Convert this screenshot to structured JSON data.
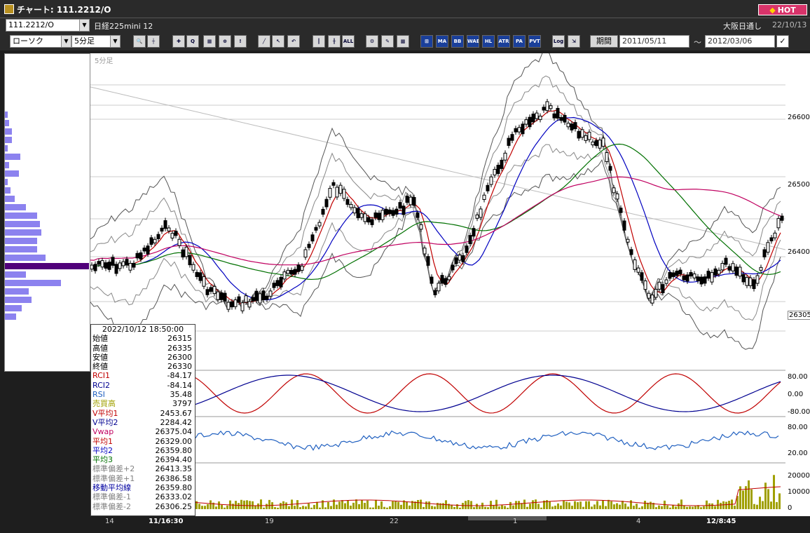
{
  "window": {
    "title": "チャート: 111.2212/O",
    "hot_label": "HOT"
  },
  "selector": {
    "symbol": "111.2212/O",
    "name": "日経225mini 12",
    "exchange": "大阪日通し",
    "date": "22/10/13",
    "chart_type": "ローソク",
    "interval": "5分足"
  },
  "toolbar": {
    "buttons": [
      {
        "name": "zoom-icon",
        "label": "🔍"
      },
      {
        "name": "crosshair-icon",
        "label": "┼"
      },
      {
        "name": "mark-icon",
        "label": "✚"
      },
      {
        "name": "zoom-chart-icon",
        "label": "Q"
      },
      {
        "name": "fit-icon",
        "label": "▦"
      },
      {
        "name": "split-icon",
        "label": "⊕"
      },
      {
        "name": "info-icon",
        "label": "!"
      },
      {
        "name": "draw-line-icon",
        "label": "╱"
      },
      {
        "name": "cursor-icon",
        "label": "↖"
      },
      {
        "name": "undo-icon",
        "label": "↶"
      },
      {
        "name": "candle-icon",
        "label": "║"
      },
      {
        "name": "candle2-icon",
        "label": "╫"
      },
      {
        "name": "all-icon",
        "label": "ALL"
      },
      {
        "name": "settings-icon",
        "label": "⚙"
      },
      {
        "name": "tool-icon",
        "label": "✎"
      },
      {
        "name": "color-icon",
        "label": "▩"
      },
      {
        "name": "grid-icon",
        "label": "⊞"
      },
      {
        "name": "ma-icon",
        "label": "MA"
      },
      {
        "name": "bb-icon",
        "label": "BB"
      },
      {
        "name": "wae-icon",
        "label": "WAE"
      },
      {
        "name": "hl-icon",
        "label": "HL"
      },
      {
        "name": "atr-icon",
        "label": "ATR"
      },
      {
        "name": "pa-icon",
        "label": "PA"
      },
      {
        "name": "pvt-icon",
        "label": "PVT"
      },
      {
        "name": "log-icon",
        "label": "Log"
      },
      {
        "name": "export-icon",
        "label": "⇲"
      }
    ],
    "period_label": "期間",
    "date_from": "2011/05/11",
    "date_to": "2012/03/06",
    "tilde": "〜"
  },
  "chart": {
    "interval_label": "5分足",
    "price_labels": [
      "26600",
      "26500",
      "26400"
    ],
    "current_price": "26305",
    "rci_labels": [
      "80.00",
      "0.00",
      "-80.00"
    ],
    "rsi_labels": [
      "80.00",
      "20.00"
    ],
    "volume_labels": [
      "20000",
      "10000",
      "0"
    ],
    "x_labels": [
      {
        "text": "14",
        "bold": false
      },
      {
        "text": "11/16:30",
        "bold": true
      },
      {
        "text": "19",
        "bold": false
      },
      {
        "text": "22",
        "bold": false
      },
      {
        "text": "1",
        "bold": false
      },
      {
        "text": "4",
        "bold": false
      },
      {
        "text": "12/8:45",
        "bold": true
      }
    ]
  },
  "info": {
    "datetime": "2022/10/12   18:50:00",
    "rows": [
      {
        "k": "始値",
        "v": "26315",
        "color": "#000000"
      },
      {
        "k": "高値",
        "v": "26335",
        "color": "#000000"
      },
      {
        "k": "安値",
        "v": "26300",
        "color": "#000000"
      },
      {
        "k": "終値",
        "v": "26330",
        "color": "#000000"
      },
      {
        "k": "RCI1",
        "v": "-84.17",
        "color": "#c00000"
      },
      {
        "k": "RCI2",
        "v": "-84.14",
        "color": "#000090"
      },
      {
        "k": "RSI",
        "v": "35.48",
        "color": "#2060c0"
      },
      {
        "k": "売買高",
        "v": "3797",
        "color": "#a0a000"
      },
      {
        "k": "V平均1",
        "v": "2453.67",
        "color": "#c00000"
      },
      {
        "k": "V平均2",
        "v": "2284.42",
        "color": "#000090"
      },
      {
        "k": "Vwap",
        "v": "26375.04",
        "color": "#c00060"
      },
      {
        "k": "平均1",
        "v": "26329.00",
        "color": "#c00000"
      },
      {
        "k": "平均2",
        "v": "26359.80",
        "color": "#0000c0"
      },
      {
        "k": "平均3",
        "v": "26394.40",
        "color": "#007000"
      },
      {
        "k": "標準偏差+2",
        "v": "26413.35",
        "color": "#808080"
      },
      {
        "k": "標準偏差+1",
        "v": "26386.58",
        "color": "#808080"
      },
      {
        "k": "移動平均線",
        "v": "26359.80",
        "color": "#0000a0"
      },
      {
        "k": "標準偏差-1",
        "v": "26333.02",
        "color": "#808080"
      },
      {
        "k": "標準偏差-2",
        "v": "26306.25",
        "color": "#808080"
      }
    ]
  }
}
